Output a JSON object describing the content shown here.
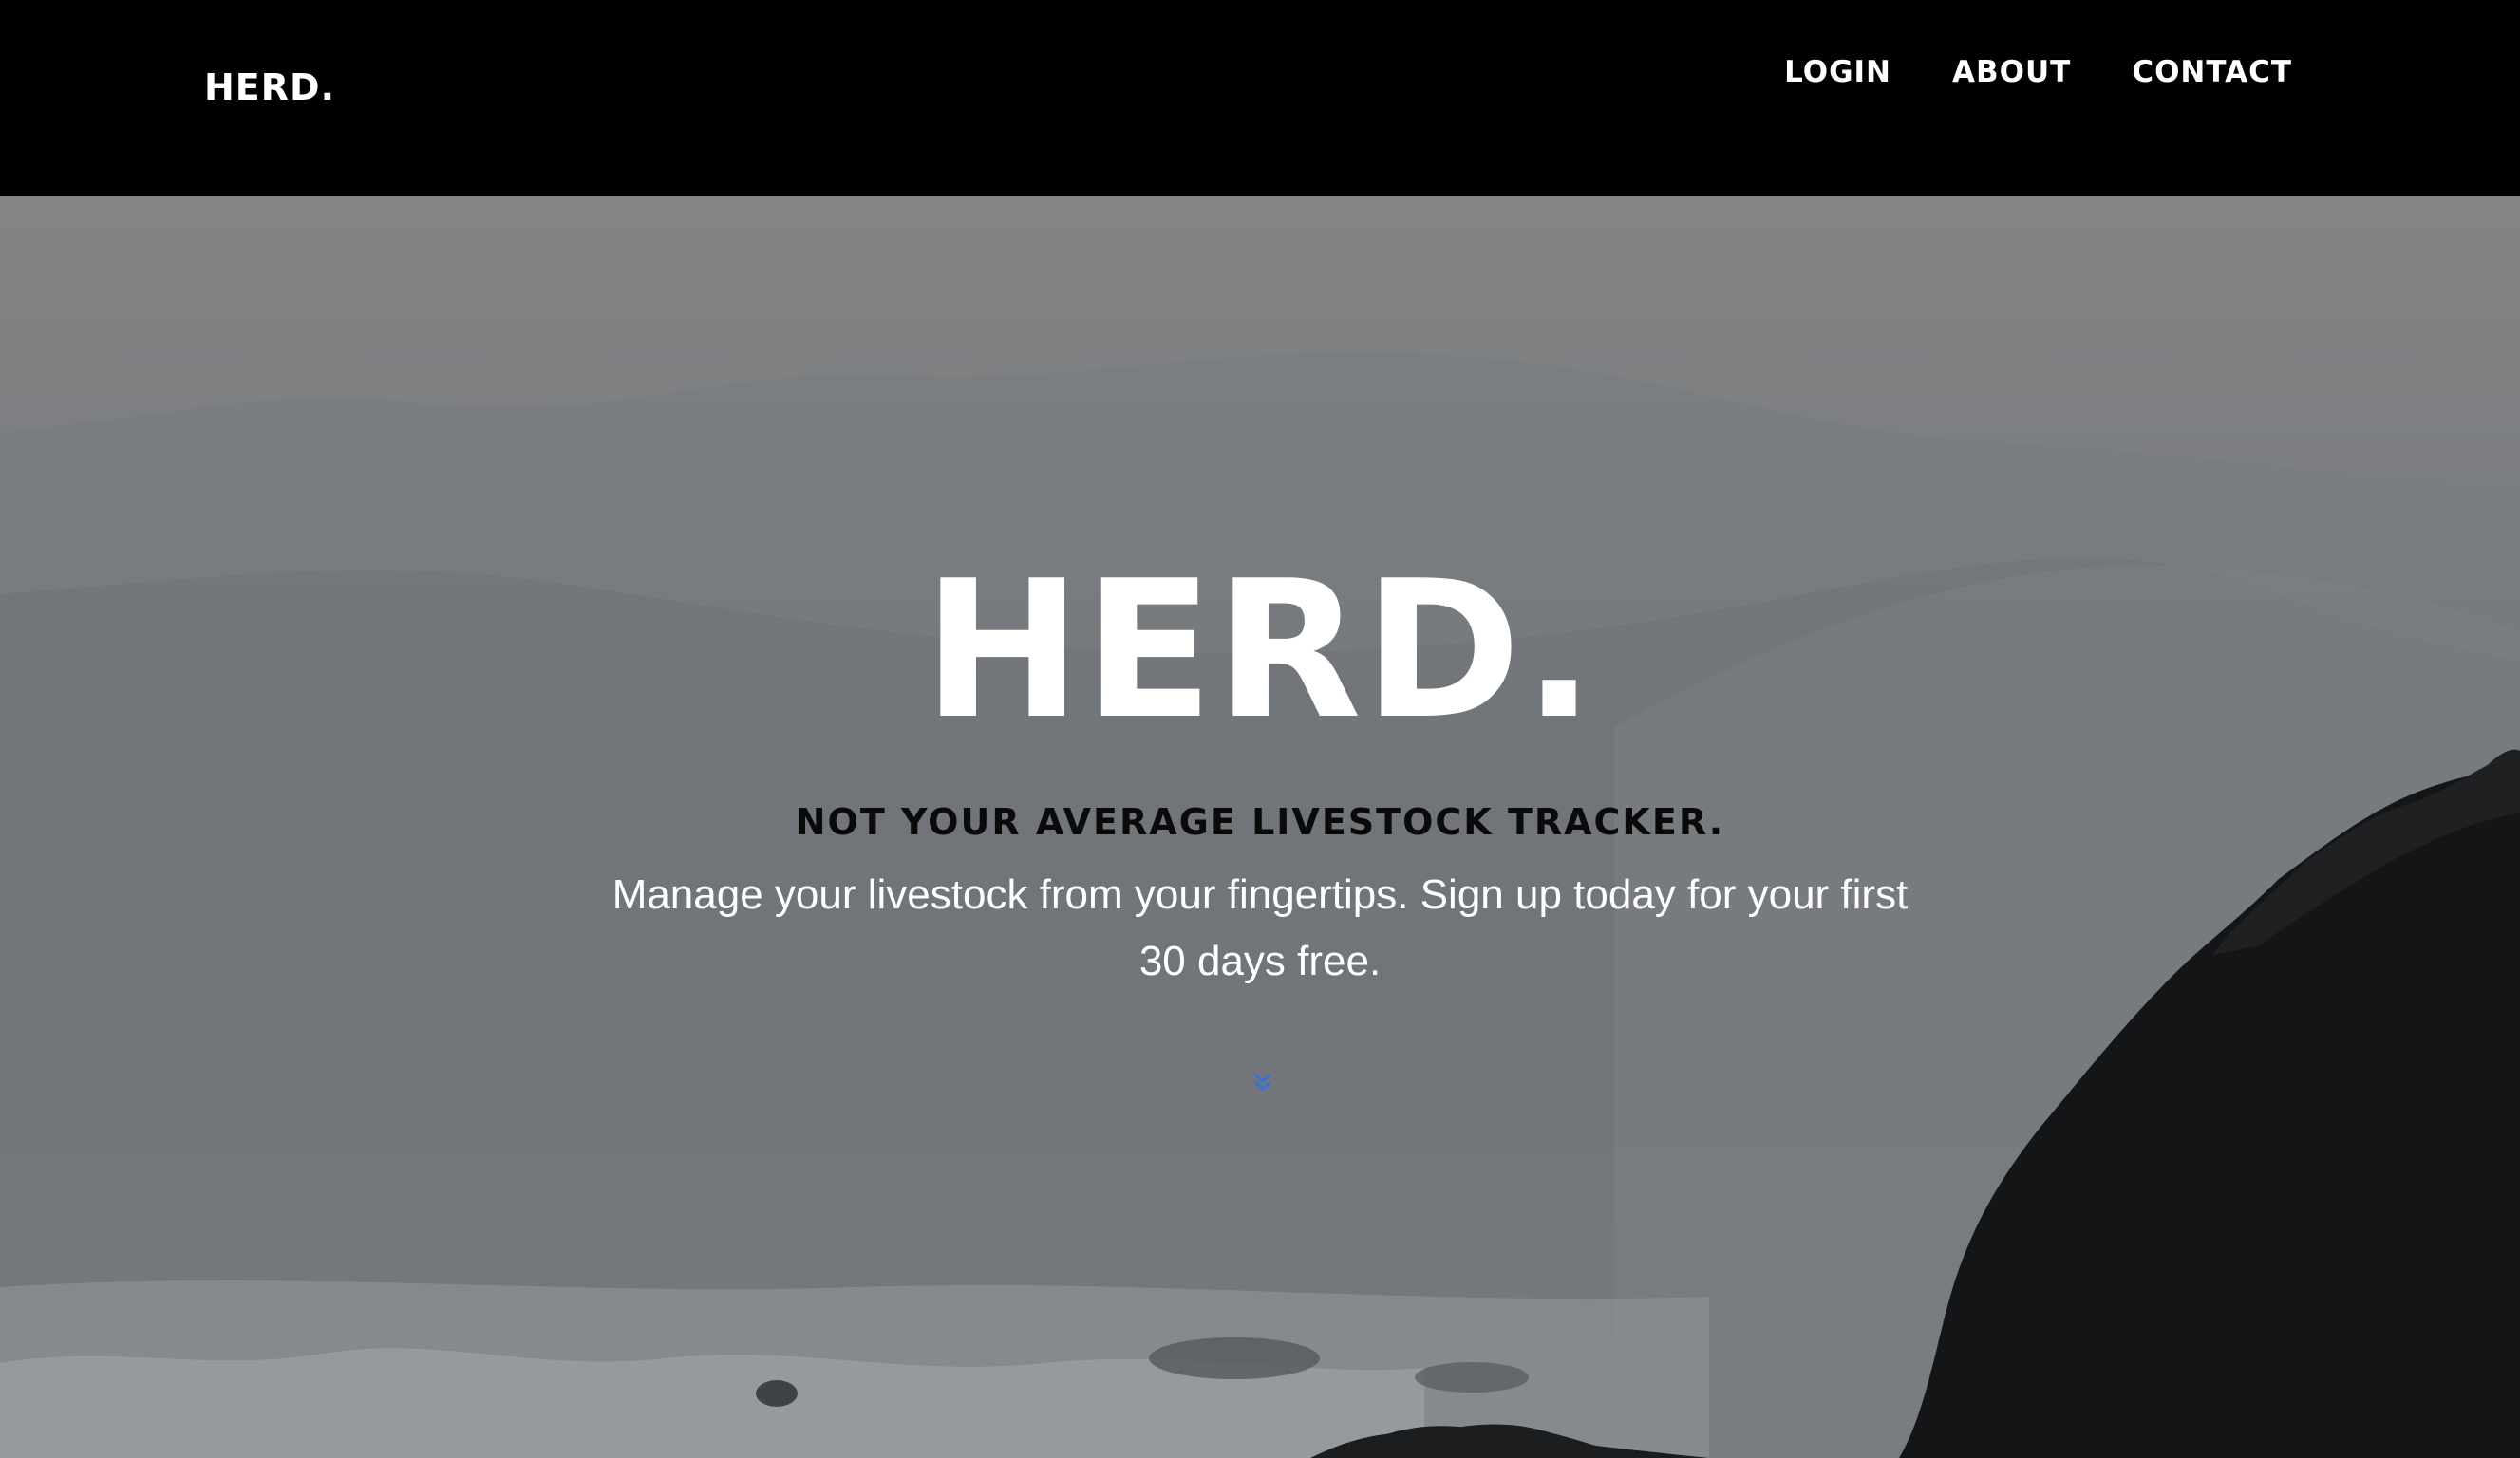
{
  "navbar": {
    "brand": "HERD.",
    "links": [
      {
        "label": "LOGIN"
      },
      {
        "label": "ABOUT"
      },
      {
        "label": "CONTACT"
      }
    ]
  },
  "hero": {
    "title": "HERD.",
    "tagline": "NOT YOUR AVERAGE LIVESTOCK TRACKER.",
    "description": "Manage your livestock from your fingertips. Sign up today for your first 30 days free.",
    "scroll_icon": "double-chevron-down-icon"
  },
  "colors": {
    "navbar_bg": "#000000",
    "text_light": "#ffffff",
    "tagline_text": "#0a0a0a",
    "chevron_accent": "#3b6fd4"
  }
}
